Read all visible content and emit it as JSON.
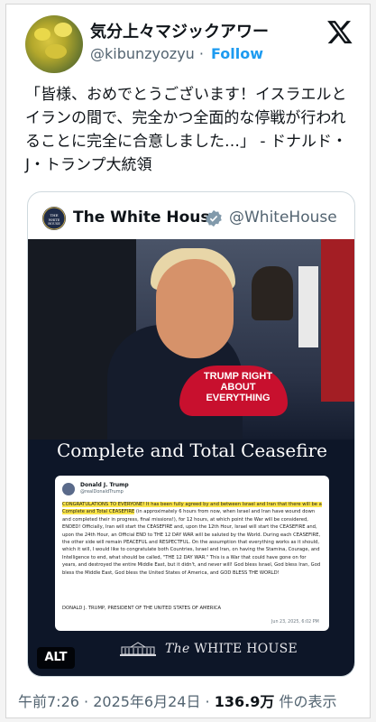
{
  "user": {
    "name": "気分上々マジックアワー",
    "handle": "@kibunzyozyu",
    "separator": "·",
    "follow_label": "Follow"
  },
  "tweet": {
    "text": "「皆様、おめでとうございます！イスラエルとイランの間で、完全かつ全面的な停戦が行われることに完全に合意しました…」 - ドナルド・J・トランプ大統領"
  },
  "quote": {
    "name": "The White House",
    "handle": "@WhiteHouse",
    "avatar_text": "WHITE HOUSE",
    "media": {
      "hat_text": "TRUMP RIGHT ABOUT EVERYTHING",
      "title": "Complete and Total Ceasefire",
      "post": {
        "author": "Donald J. Trump",
        "author_handle": "@realDonaldTrump",
        "body_highlight": "CONGRATULATIONS TO EVERYONE! It has been fully agreed by and between Israel and Iran that there will be a Complete and Total CEASEFIRE",
        "body": " (in approximately 6 hours from now, when Israel and Iran have wound down and completed their in progress, final missions!), for 12 hours, at which point the War will be considered, ENDED! Officially, Iran will start the CEASEFIRE and, upon the 12th Hour, Israel will start the CEASEFIRE and, upon the 24th Hour, an Official END to THE 12 DAY WAR will be saluted by the World. During each CEASEFIRE, the other side will remain PEACEFUL and RESPECTFUL. On the assumption that everything works as it should, which it will, I would like to congratulate both Countries, Israel and Iran, on having the Stamina, Courage, and Intelligence to end, what should be called, \"THE 12 DAY WAR.\" This is a War that could have gone on for years, and destroyed the entire Middle East, but it didn't, and never will! God bless Israel, God bless Iran, God bless the Middle East, God bless the United States of America, and GOD BLESS THE WORLD!",
        "signature": "DONALD J. TRUMP, PRESIDENT OF THE UNITED STATES OF AMERICA",
        "date": "Jun 23, 2025, 6:02 PM"
      },
      "footer_the": "The",
      "footer_name": "WHITE HOUSE",
      "alt_label": "ALT"
    }
  },
  "meta": {
    "time": "午前7:26",
    "sep1": " · ",
    "date": "2025年6月24日",
    "sep2": " · ",
    "views": "136.9万",
    "views_suffix": " 件の表示"
  },
  "colors": {
    "accent": "#1d9bf0",
    "text": "#0f1419",
    "muted": "#536471",
    "verified_gold": "#829aab"
  }
}
